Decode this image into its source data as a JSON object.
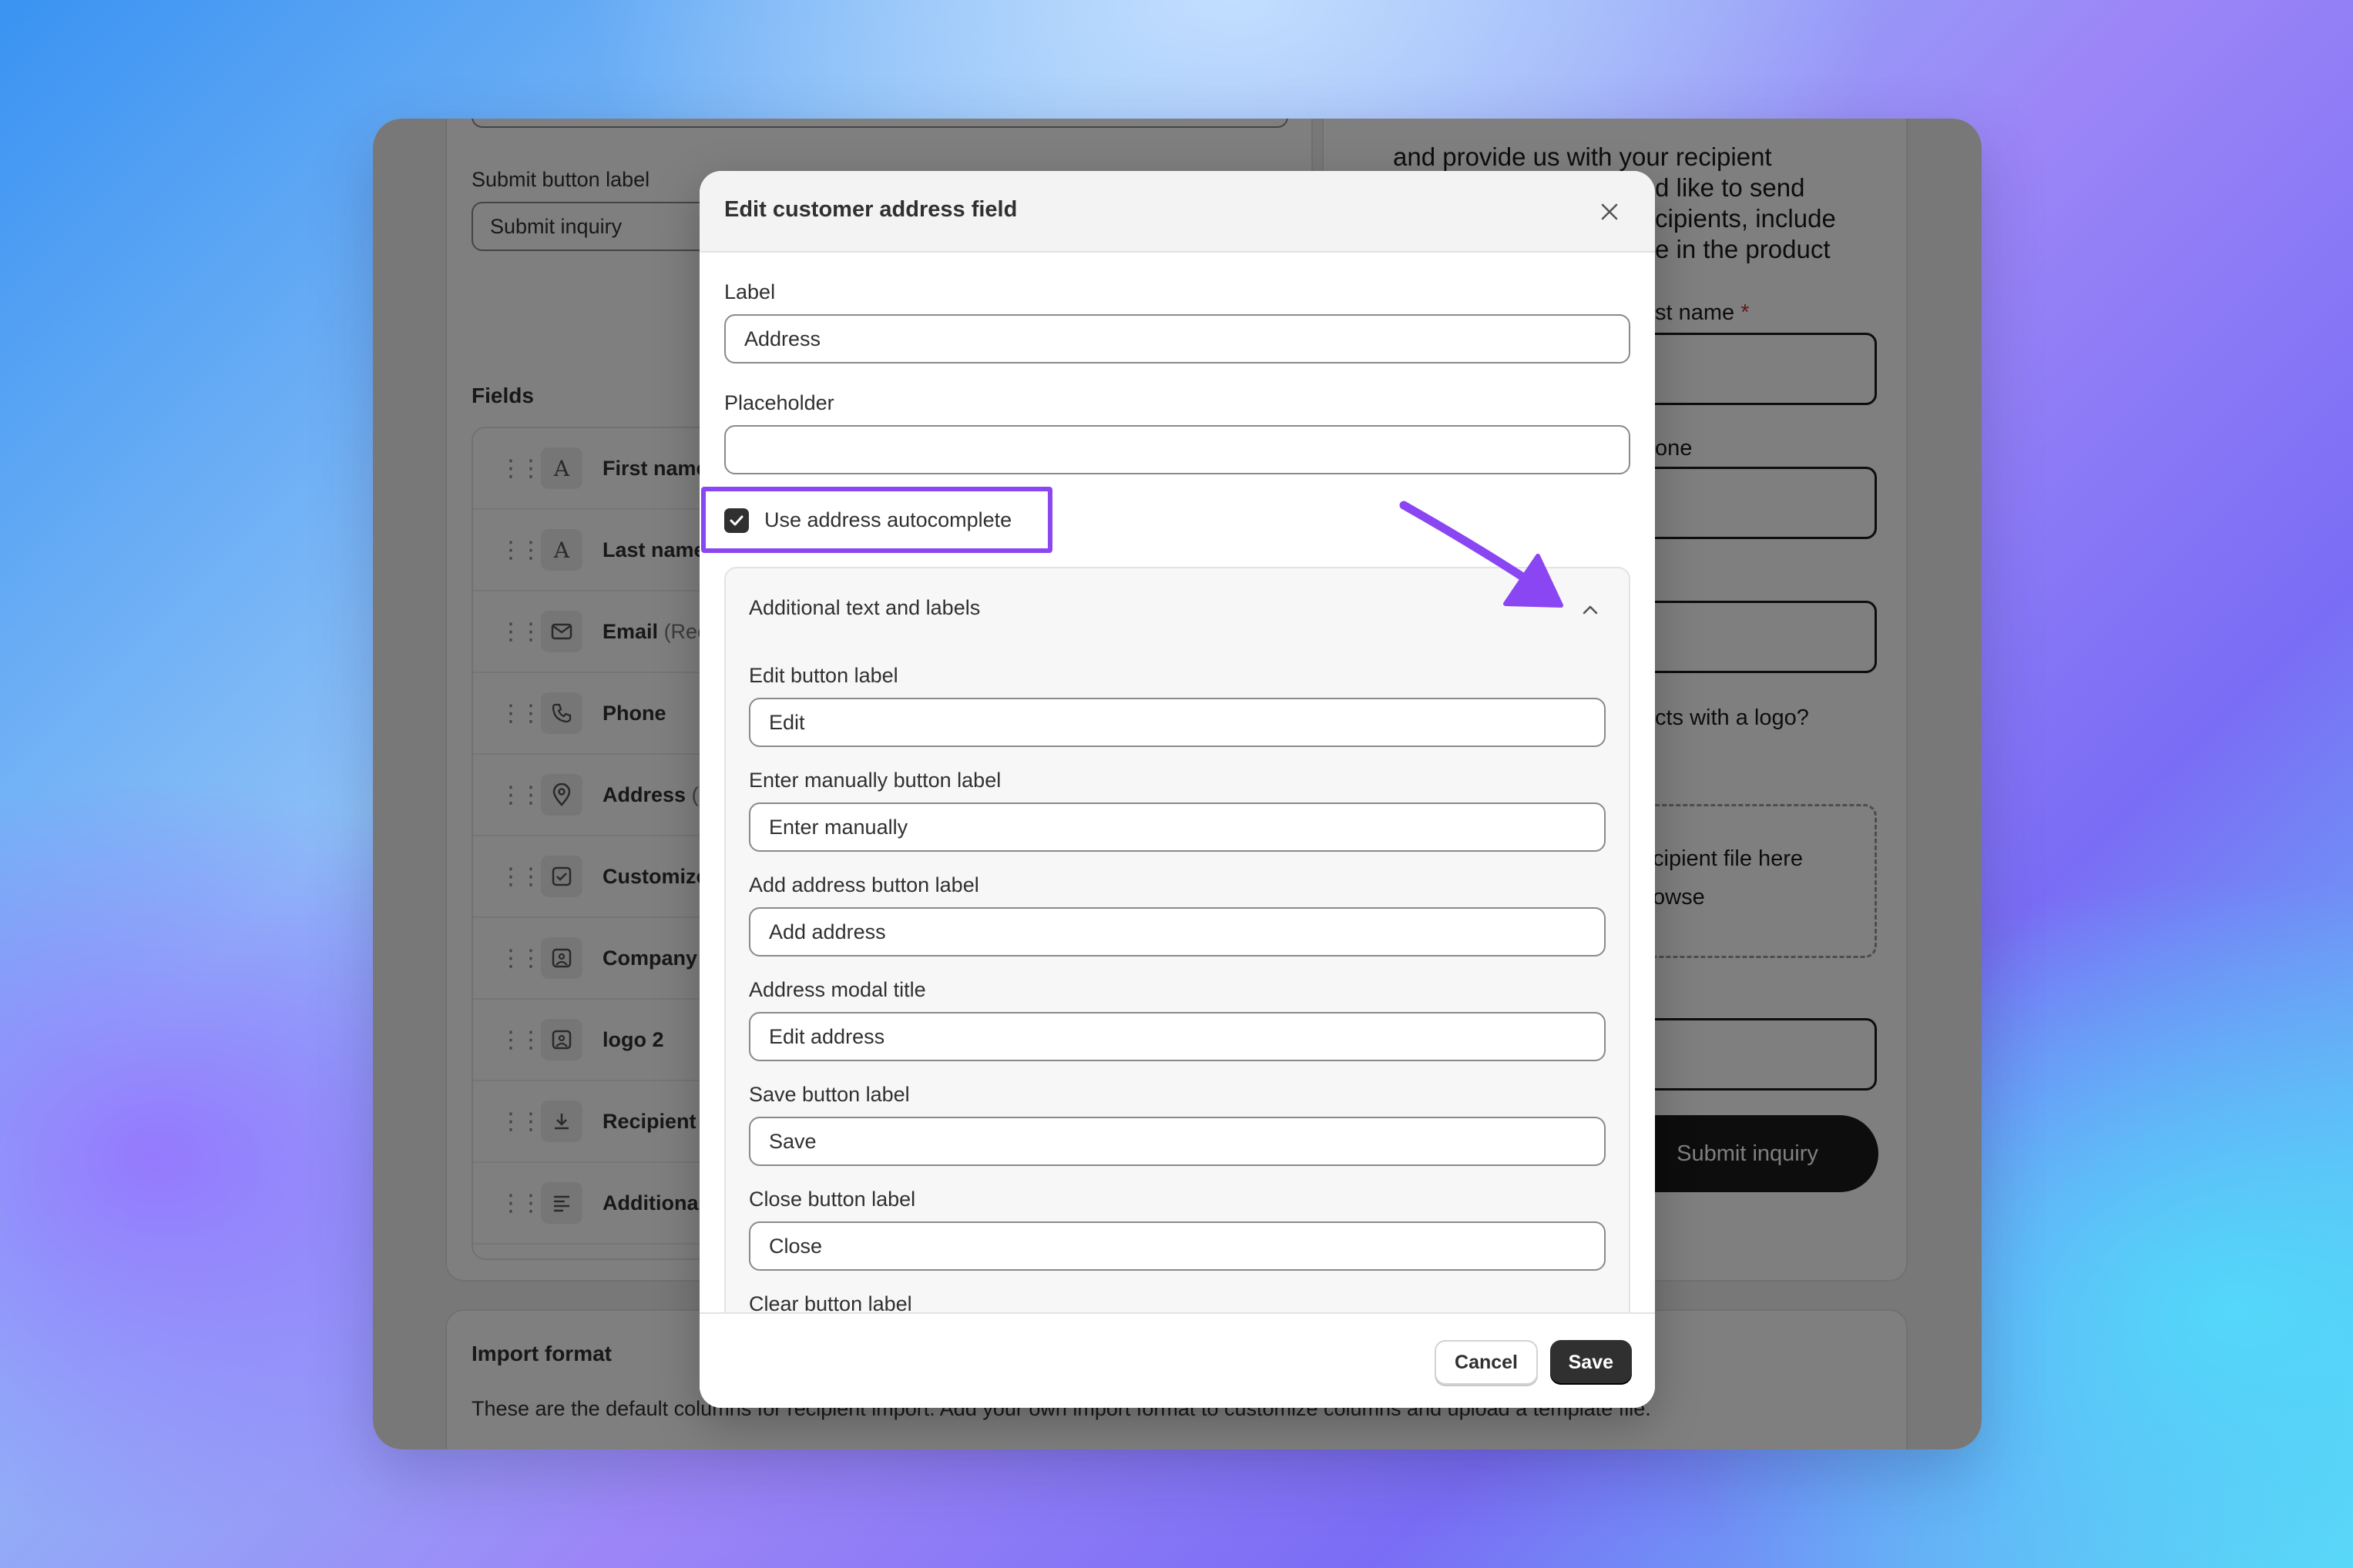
{
  "background_app": {
    "submit_button_label_caption": "Submit button label",
    "submit_button_label_value": "Submit inquiry",
    "fields_title": "Fields",
    "fields": [
      {
        "name": "First name",
        "sub": "",
        "icon": "text-icon"
      },
      {
        "name": "Last name",
        "sub": "",
        "icon": "text-icon"
      },
      {
        "name": "Email",
        "sub": "(Rec",
        "icon": "mail-icon"
      },
      {
        "name": "Phone",
        "sub": "",
        "icon": "phone-icon"
      },
      {
        "name": "Address",
        "sub": "(R",
        "icon": "location-pin-icon"
      },
      {
        "name": "Customize",
        "sub": "",
        "icon": "checkbox-icon"
      },
      {
        "name": "Company",
        "sub": "",
        "icon": "image-icon"
      },
      {
        "name": "logo 2",
        "sub": "",
        "icon": "image-icon"
      },
      {
        "name": "Recipient",
        "sub": "",
        "icon": "download-icon"
      },
      {
        "name": "Additional",
        "sub": "",
        "icon": "paragraph-icon"
      }
    ],
    "import_format_title": "Import format",
    "import_format_text": "These are the default columns for recipient import. Add your own import format to customize columns and upload a template file."
  },
  "preview": {
    "intro_text": "and provide us with your recipient d like to send cipients, include e in the product",
    "intro_lines": [
      "and provide us with your recipient",
      "d like to send",
      "cipients, include",
      "e in the product"
    ],
    "last_name_label": "st name",
    "required_mark": "*",
    "phone_label": "one",
    "logo_question": "cts with a logo?",
    "drop_text_1": "cipient file here",
    "drop_text_2": "owse",
    "submit_label": "Submit inquiry"
  },
  "modal": {
    "title": "Edit customer address field",
    "label_caption": "Label",
    "label_value": "Address",
    "placeholder_caption": "Placeholder",
    "placeholder_value": "",
    "autocomplete_label": "Use address autocomplete",
    "autocomplete_checked": true,
    "collapsible_title": "Additional text and labels",
    "inner_fields": [
      {
        "caption": "Edit button label",
        "value": "Edit"
      },
      {
        "caption": "Enter manually button label",
        "value": "Enter manually"
      },
      {
        "caption": "Add address button label",
        "value": "Add address"
      },
      {
        "caption": "Address modal title",
        "value": "Edit address"
      },
      {
        "caption": "Save button label",
        "value": "Save"
      },
      {
        "caption": "Close button label",
        "value": "Close"
      }
    ],
    "clear_caption": "Clear button label",
    "cancel_label": "Cancel",
    "save_label": "Save"
  },
  "colors": {
    "highlight": "#8a46f2",
    "primary_button": "#303030"
  }
}
